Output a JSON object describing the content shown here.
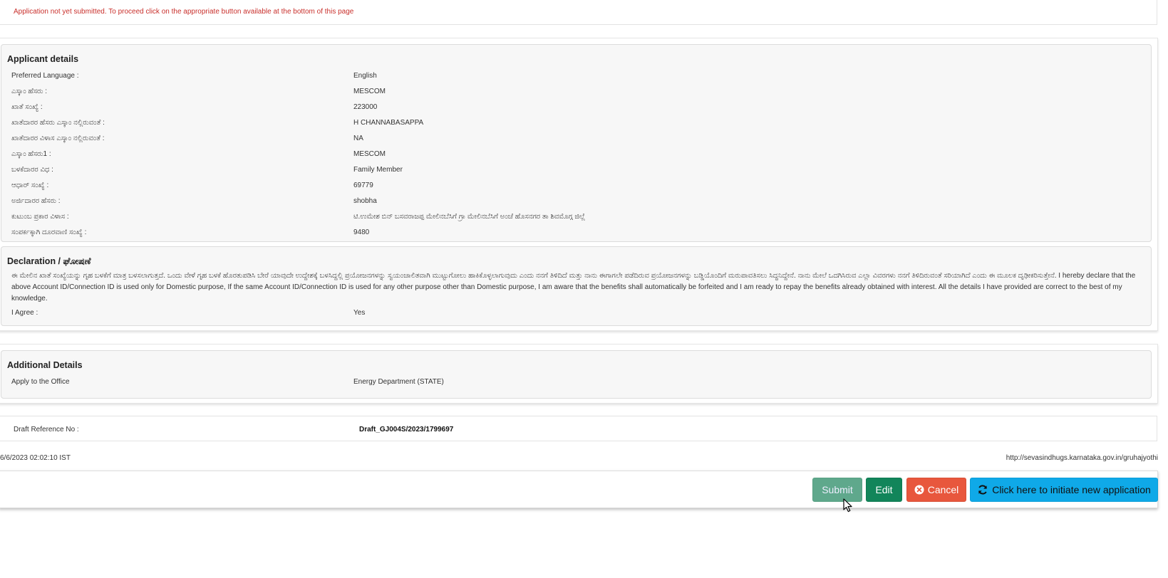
{
  "notice": "Application not yet submitted. To proceed click on the appropriate button available at the bottom of this page",
  "applicant": {
    "title": "Applicant details",
    "rows": [
      {
        "label": "Preferred Language :",
        "value": "English"
      },
      {
        "label": "ಎಸ್ಕಾಂ ಹೆಸರು :",
        "value": "MESCOM"
      },
      {
        "label": "ಖಾತೆ ಸಂಖ್ಯೆ :",
        "value": "223000"
      },
      {
        "label": "ಖಾತೆದಾರರ ಹೆಸರು ಎಸ್ಕಾಂ ನಲ್ಲಿರುವಂತೆ :",
        "value": "H CHANNABASAPPA"
      },
      {
        "label": "ಖಾತೆದಾರರ ವಿಳಾಸ ಎಸ್ಕಾಂ ನಲ್ಲಿರುವಂತೆ :",
        "value": "NA"
      },
      {
        "label": "ಎಸ್ಕಾಂ ಹೆಸರು1 :",
        "value": "MESCOM"
      },
      {
        "label": "ಬಳಕೆದಾರರ ವಿಧ :",
        "value": "Family Member"
      },
      {
        "label": "ಆಧಾರ್ ಸಂಖ್ಯೆ :",
        "value": "69779"
      },
      {
        "label": "ಅರ್ಜಿದಾರರ ಹೆಸರು :",
        "value": "shobha"
      },
      {
        "label": "ಕುಟುಂಬ ಪ್ರಕಾರ ವಿಳಾಸ :",
        "value": "ಟಿ.ಉಮೇಶ ಬಿನ್ ಬಸವರಾಜಪ್ಪ ಮೇಲಿನಬೆಸಿಗೆ ಗ್ರಾ ಮೇಲಿನಬೆಸಿಗೆ ಅಂಚೆ ಹೊಸನಗರ ತಾ ಶಿವಮೊಗ್ಗ ಜಿಲ್ಲೆ"
      },
      {
        "label": "ಸಂಪರ್ಕಕ್ಕಾಗಿ ದೂರವಾಣಿ ಸಂಖ್ಯೆ :",
        "value": "9480"
      }
    ]
  },
  "declaration": {
    "title": "Declaration / ಘೋಷಣೆ",
    "text": "ಈ ಮೇಲಿನ ಖಾತೆ ಸಂಖ್ಯೆಯನ್ನು ಗೃಹ ಬಳಕೆಗೆ ಮಾತ್ರ ಬಳಸಲಾಗುತ್ತದೆ. ಒಂದು ವೇಳೆ ಗೃಹ ಬಳಕೆ ಹೊರತುಪಡಿಸಿ ಬೇರೆ ಯಾವುದೇ ಉದ್ದೇಶಕ್ಕೆ ಬಳಸಿದ್ದಲ್ಲಿ ಪ್ರಯೋಜನಗಳನ್ನು ಸ್ವಯಂಚಾಲಿತವಾಗಿ ಮುಟ್ಟುಗೋಲು ಹಾಕಿಕೊಳ್ಳಲಾಗುವುದು ಎಂದು ನನಗೆ ತಿಳಿದಿದೆ ಮತ್ತು ನಾನು ಈಗಾಗಲೇ ಪಡೆದಿರುವ ಪ್ರಯೋಜನಗಳನ್ನು ಬಡ್ಡಿಯೊಂದಿಗೆ ಮರುಪಾವತಿಸಲು ಸಿದ್ಧನಿದ್ದೇನೆ. ನಾನು ಮೇಲೆ ಒದಗಿಸಿರುವ ಎಲ್ಲಾ ವಿವರಗಳು ನನಗೆ ತಿಳಿದಿರುವಂತೆ ಸರಿಯಾಗಿದೆ ಎಂದು ಈ ಮೂಲಕ ದೃಢೀಕರಿಸುತ್ತೇನೆ. I hereby declare that the above Account ID/Connection ID is used only for Domestic purpose, If the same Account ID/Connection ID is used for any other purpose other than Domestic purpose, I am aware that the benefits shall automatically be forfeited and I am ready to repay the benefits already obtained with interest. All the details I have provided are correct to the best of my knowledge.",
    "agree_label": "I Agree :",
    "agree_value": "Yes"
  },
  "additional": {
    "title": "Additional Details",
    "office_label": "Apply to the Office",
    "office_value": "Energy Department (STATE)"
  },
  "draft": {
    "label": "Draft Reference No :",
    "value": "Draft_GJ004S/2023/1799697"
  },
  "footer": {
    "timestamp": "6/6/2023 02:02:10 IST",
    "url": "http://sevasindhugs.karnataka.gov.in/gruhajyothi"
  },
  "buttons": {
    "submit": "Submit",
    "edit": "Edit",
    "cancel": "Cancel",
    "new_application": "Click here to initiate new application"
  },
  "icons": {
    "cancel": "times-circle-icon",
    "new_application": "refresh-icon",
    "cursor": "mouse-pointer-icon"
  },
  "colors": {
    "notice": "#c9302c",
    "submit": "#5fa88c",
    "edit": "#12855a",
    "cancel": "#e8573d",
    "new_application": "#0fa9e8"
  }
}
